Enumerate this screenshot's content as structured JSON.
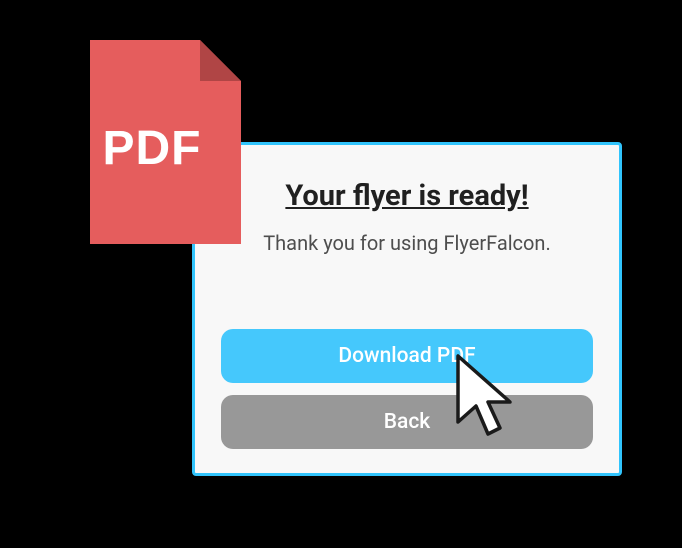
{
  "pdf_icon": {
    "label": "PDF"
  },
  "dialog": {
    "title": "Your flyer is ready!",
    "subtitle": "Thank you for using FlyerFalcon.",
    "download_label": "Download PDF",
    "back_label": "Back"
  },
  "colors": {
    "pdf_red": "#e55d5d",
    "pdf_fold": "#b04545",
    "accent": "#31c4fc",
    "primary_btn": "#45c8fc",
    "secondary_btn": "#989898"
  }
}
